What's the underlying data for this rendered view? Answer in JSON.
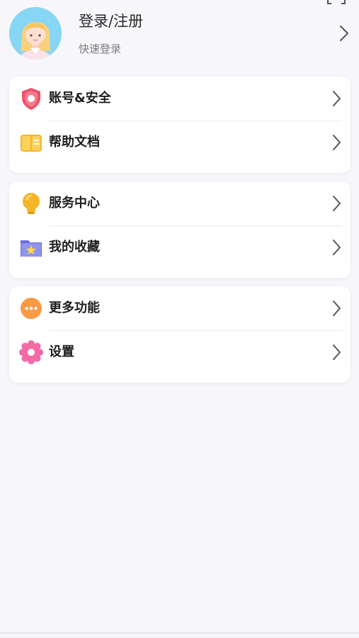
{
  "header": {
    "title": "登录/注册",
    "subtitle": "快速登录",
    "avatar_icon": "avatar-girl-icon",
    "scan_icon": "scan-icon",
    "chevron_icon": "chevron-right-icon"
  },
  "menu_groups": [
    {
      "items": [
        {
          "label": "账号&安全",
          "icon": "shield-icon"
        },
        {
          "label": "帮助文档",
          "icon": "book-icon"
        }
      ]
    },
    {
      "items": [
        {
          "label": "服务中心",
          "icon": "lightbulb-icon"
        },
        {
          "label": "我的收藏",
          "icon": "folder-star-icon"
        }
      ]
    },
    {
      "items": [
        {
          "label": "更多功能",
          "icon": "more-dots-icon"
        },
        {
          "label": "设置",
          "icon": "gear-flower-icon"
        }
      ]
    }
  ],
  "colors": {
    "background": "#f7f6fb",
    "card": "#ffffff",
    "shield": "#f0506a",
    "book": "#f6b628",
    "bulb": "#f6b628",
    "folder": "#7f84e6",
    "more": "#f99a47",
    "gear": "#f56aa6"
  }
}
